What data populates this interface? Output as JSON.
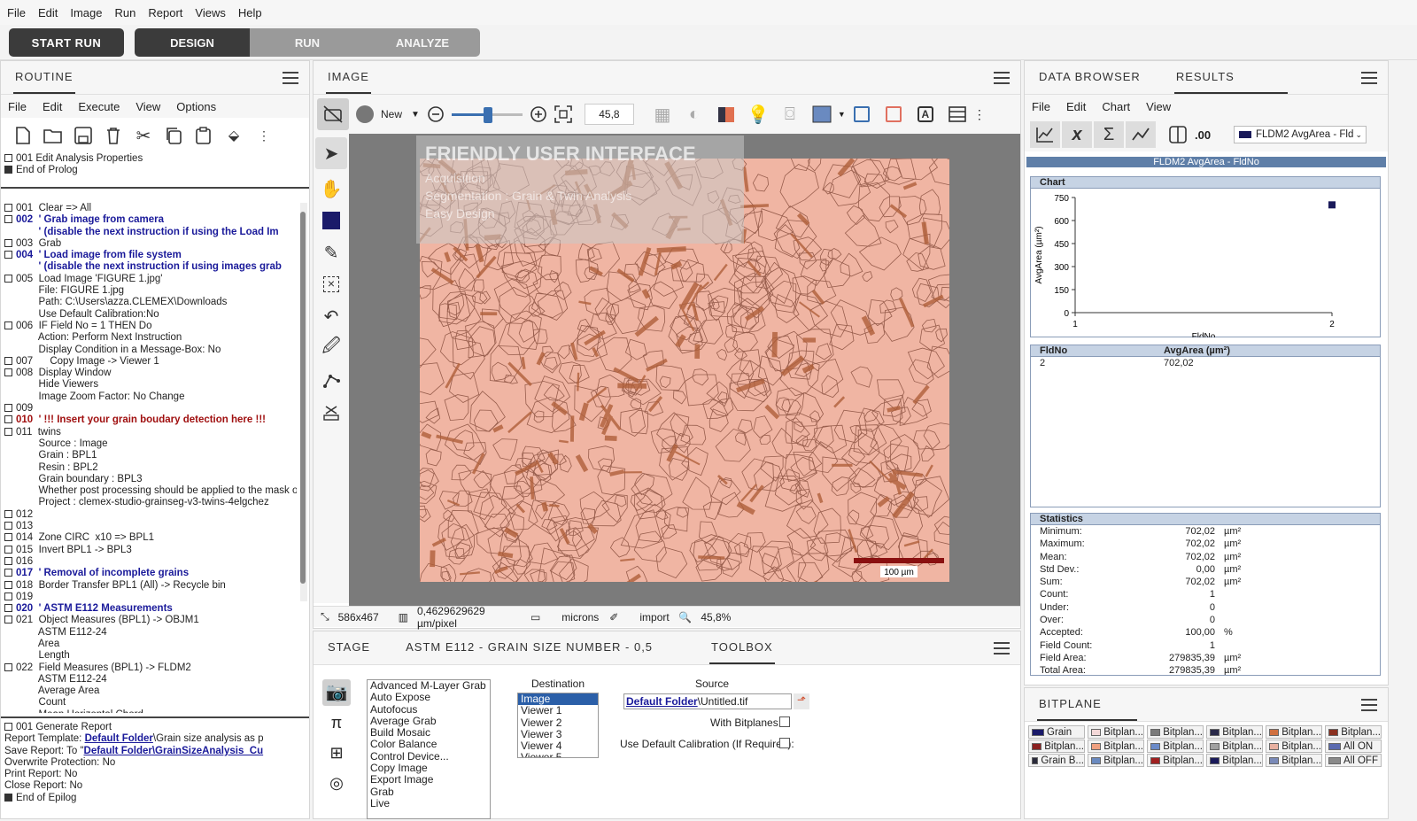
{
  "menu": [
    "File",
    "Edit",
    "Image",
    "Run",
    "Report",
    "Views",
    "Help"
  ],
  "runbar": {
    "start_run": "START RUN",
    "modes": [
      "DESIGN",
      "RUN",
      "ANALYZE"
    ],
    "active_mode": "DESIGN"
  },
  "routine": {
    "tab": "ROUTINE",
    "menu": [
      "File",
      "Edit",
      "Execute",
      "View",
      "Options"
    ],
    "prolog": [
      "001  Edit Analysis Properties",
      "End of Prolog"
    ],
    "lines": [
      {
        "t": "001  Clear => All",
        "c": "",
        "b": true
      },
      {
        "t": "002  ' Grab image from camera",
        "c": "blue",
        "b": true
      },
      {
        "t": "        ' (disable the next instruction if using the Load Im",
        "c": "blue",
        "b": false
      },
      {
        "t": "003  Grab",
        "c": "",
        "b": true
      },
      {
        "t": "004  ' Load image from file system",
        "c": "blue",
        "b": true
      },
      {
        "t": "        ' (disable the next instruction if using images grab",
        "c": "blue",
        "b": false
      },
      {
        "t": "005  Load Image 'FIGURE 1.jpg'",
        "c": "",
        "b": true
      },
      {
        "t": "        File: FIGURE 1.jpg",
        "c": "",
        "b": false
      },
      {
        "t": "        Path: C:\\Users\\azza.CLEMEX\\Downloads",
        "c": "",
        "b": false
      },
      {
        "t": "        Use Default Calibration:No",
        "c": "",
        "b": false
      },
      {
        "t": "006  IF Field No = 1 THEN Do",
        "c": "",
        "b": true
      },
      {
        "t": "        Action: Perform Next Instruction",
        "c": "",
        "b": false
      },
      {
        "t": "        Display Condition in a Message-Box: No",
        "c": "",
        "b": false
      },
      {
        "t": "007      Copy Image -> Viewer 1",
        "c": "",
        "b": true
      },
      {
        "t": "008  Display Window",
        "c": "",
        "b": true
      },
      {
        "t": "        Hide Viewers",
        "c": "",
        "b": false
      },
      {
        "t": "        Image Zoom Factor: No Change",
        "c": "",
        "b": false
      },
      {
        "t": "009",
        "c": "",
        "b": true
      },
      {
        "t": "010  ' !!! Insert your grain boudary detection here !!!",
        "c": "red",
        "b": true
      },
      {
        "t": "011  twins",
        "c": "",
        "b": true
      },
      {
        "t": "        Source : Image",
        "c": "",
        "b": false
      },
      {
        "t": "        Grain : BPL1",
        "c": "",
        "b": false
      },
      {
        "t": "        Resin : BPL2",
        "c": "",
        "b": false
      },
      {
        "t": "        Grain boundary : BPL3",
        "c": "",
        "b": false
      },
      {
        "t": "        Whether post processing should be applied to the mask or r",
        "c": "",
        "b": false
      },
      {
        "t": "        Project : clemex-studio-grainseg-v3-twins-4elgchez",
        "c": "",
        "b": false
      },
      {
        "t": "012",
        "c": "",
        "b": true
      },
      {
        "t": "013",
        "c": "",
        "b": true
      },
      {
        "t": "014  Zone CIRC  x10 => BPL1",
        "c": "",
        "b": true
      },
      {
        "t": "015  Invert BPL1 -> BPL3",
        "c": "",
        "b": true
      },
      {
        "t": "016",
        "c": "",
        "b": true
      },
      {
        "t": "017  ' Removal of incomplete grains",
        "c": "blue",
        "b": true
      },
      {
        "t": "018  Border Transfer BPL1 (All) -> Recycle bin",
        "c": "",
        "b": true
      },
      {
        "t": "019",
        "c": "",
        "b": true
      },
      {
        "t": "020  ' ASTM E112 Measurements",
        "c": "blue",
        "b": true
      },
      {
        "t": "021  Object Measures (BPL1) -> OBJM1",
        "c": "",
        "b": true
      },
      {
        "t": "        ASTM E112-24",
        "c": "",
        "b": false
      },
      {
        "t": "        Area",
        "c": "",
        "b": false
      },
      {
        "t": "        Length",
        "c": "",
        "b": false
      },
      {
        "t": "022  Field Measures (BPL1) -> FLDM2",
        "c": "",
        "b": true
      },
      {
        "t": "        ASTM E112-24",
        "c": "",
        "b": false
      },
      {
        "t": "        Average Area",
        "c": "",
        "b": false
      },
      {
        "t": "        Count",
        "c": "",
        "b": false
      },
      {
        "t": "        Mean Horizontal Chord",
        "c": "",
        "b": false
      }
    ],
    "epilog": {
      "l1": "001  Generate Report",
      "l2a": "        Report Template: ",
      "l2b": "Default Folder",
      "l2c": "\\Grain size analysis as p",
      "l3a": "        Save Report:  To \"",
      "l3b": "Default Folder",
      "l3c": "\\GrainSizeAnalysis_Cu",
      "l4": "        Overwrite Protection: No",
      "l5": "        Print Report: No",
      "l6": "        Close Report: No",
      "l7": "End of Epilog"
    }
  },
  "image": {
    "tab": "IMAGE",
    "new_label": "New",
    "zoom_value": "45,8",
    "overlay_title": "FRIENDLY USER INTERFACE",
    "overlay_lines": [
      "Acquisition",
      "Segmentation : Grain & Twin Analysis",
      "Easy  Design"
    ],
    "scale_label": "100 µm",
    "status": {
      "size": "586x467",
      "calib": "0,4629629629 µm/pixel",
      "units": "microns",
      "source": "import",
      "zoom": "45,8%"
    }
  },
  "bottom": {
    "tabs": [
      "STAGE",
      "ASTM E112 - GRAIN SIZE NUMBER - 0,5",
      "TOOLBOX"
    ],
    "selected_tab": "TOOLBOX",
    "tools": [
      "Advanced M-Layer Grab",
      "Auto Expose",
      "Autofocus",
      "Average Grab",
      "Build Mosaic",
      "Color Balance",
      "Control Device...",
      "Copy Image",
      "Export Image",
      "Grab",
      "Live"
    ],
    "destination_label": "Destination",
    "destination": [
      "Image",
      "Viewer 1",
      "Viewer 2",
      "Viewer 3",
      "Viewer 4",
      "Viewer 5"
    ],
    "source_label": "Source",
    "source_link": "Default Folder",
    "source_rest": "\\Untitled.tif",
    "with_bitplanes": "With Bitplanes:",
    "use_default_cal": "Use Default Calibration (If Required):"
  },
  "data_browser": {
    "tabs": [
      "DATA BROWSER",
      "RESULTS"
    ],
    "selected_tab": "RESULTS",
    "menu": [
      "File",
      "Edit",
      "Chart",
      "View"
    ],
    "decimals_label": ".00",
    "series_select": "FLDM2 AvgArea - Fld",
    "title": "FLDM2 AvgArea - FldNo",
    "chart_section": "Chart",
    "table_section_cols": [
      "FldNo",
      "AvgArea (µm²)"
    ],
    "table_rows": [
      [
        "2",
        "702,02"
      ]
    ],
    "stats_section": "Statistics",
    "stats": [
      {
        "n": "Minimum:",
        "v": "702,02",
        "u": "µm²"
      },
      {
        "n": "Maximum:",
        "v": "702,02",
        "u": "µm²"
      },
      {
        "n": "Mean:",
        "v": "702,02",
        "u": "µm²"
      },
      {
        "n": "Std Dev.:",
        "v": "0,00",
        "u": "µm²"
      },
      {
        "n": "Sum:",
        "v": "702,02",
        "u": "µm²"
      },
      {
        "n": "Count:",
        "v": "1",
        "u": ""
      },
      {
        "n": "Under:",
        "v": "0",
        "u": ""
      },
      {
        "n": "Over:",
        "v": "0",
        "u": ""
      },
      {
        "n": "Accepted:",
        "v": "100,00",
        "u": "%"
      },
      {
        "n": "Field Count:",
        "v": "1",
        "u": ""
      },
      {
        "n": "Field Area:",
        "v": "279835,39",
        "u": "µm²"
      },
      {
        "n": "Total Area:",
        "v": "279835,39",
        "u": "µm²"
      }
    ]
  },
  "chart_data": {
    "type": "scatter",
    "x": [
      2
    ],
    "y": [
      702.02
    ],
    "xlabel": "FldNo",
    "ylabel": "AvgArea (µm²)",
    "xlim": [
      1,
      2
    ],
    "ylim": [
      0,
      750
    ],
    "xticks": [
      "1",
      "2"
    ],
    "yticks": [
      "0",
      "150",
      "300",
      "450",
      "600",
      "750"
    ],
    "marker_color": "#1a1a5a"
  },
  "bitplane": {
    "tab": "BITPLANE",
    "items": [
      {
        "l": "Grain",
        "c": "#1a1a6a"
      },
      {
        "l": "Bitplan...",
        "c": "#f4d8d8"
      },
      {
        "l": "Bitplan...",
        "c": "#7a7a7a"
      },
      {
        "l": "Bitplan...",
        "c": "#2a2a4a"
      },
      {
        "l": "Bitplan...",
        "c": "#d07040"
      },
      {
        "l": "Bitplan...",
        "c": "#8a3020"
      },
      {
        "l": "Bitplan...",
        "c": "#8a2020"
      },
      {
        "l": "Bitplan...",
        "c": "#f0a080"
      },
      {
        "l": "Bitplan...",
        "c": "#6a8ac8"
      },
      {
        "l": "Bitplan...",
        "c": "#a0a0a0"
      },
      {
        "l": "Bitplan...",
        "c": "#e8b0a0"
      },
      {
        "l": "All ON",
        "c": "#5a6ab0"
      },
      {
        "l": "Grain B...",
        "c": "#2a2a3a"
      },
      {
        "l": "Bitplan...",
        "c": "#6a8ac0"
      },
      {
        "l": "Bitplan...",
        "c": "#a02020"
      },
      {
        "l": "Bitplan...",
        "c": "#1a1a5a"
      },
      {
        "l": "Bitplan...",
        "c": "#7a8ab8"
      },
      {
        "l": "All OFF",
        "c": "#8a8a8a"
      }
    ]
  }
}
